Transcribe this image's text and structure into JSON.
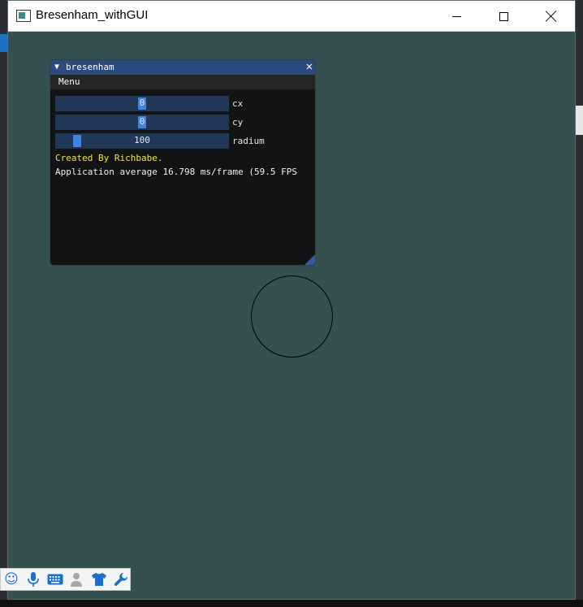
{
  "window": {
    "title": "Bresenham_withGUI"
  },
  "panel": {
    "title": "bresenham",
    "menu": "Menu",
    "sliders": [
      {
        "label": "cx",
        "value": "0",
        "fraction": 0.5
      },
      {
        "label": "cy",
        "value": "0",
        "fraction": 0.5
      },
      {
        "label": "radium",
        "value": "100",
        "fraction": 0.1
      }
    ],
    "credit": "Created By Richbabe.",
    "fps": "Application average 16.798 ms/frame (59.5 FPS"
  },
  "colors": {
    "background": "#345050",
    "panel_title": "#2b4a7e",
    "slider_bg": "#213757",
    "slider_grab": "#3d85e0",
    "credit_text": "#f0e24a"
  },
  "toolbar": {
    "icons": [
      "smiley-icon",
      "microphone-icon",
      "keyboard-icon",
      "user-icon",
      "shirt-icon",
      "wrench-icon"
    ]
  }
}
